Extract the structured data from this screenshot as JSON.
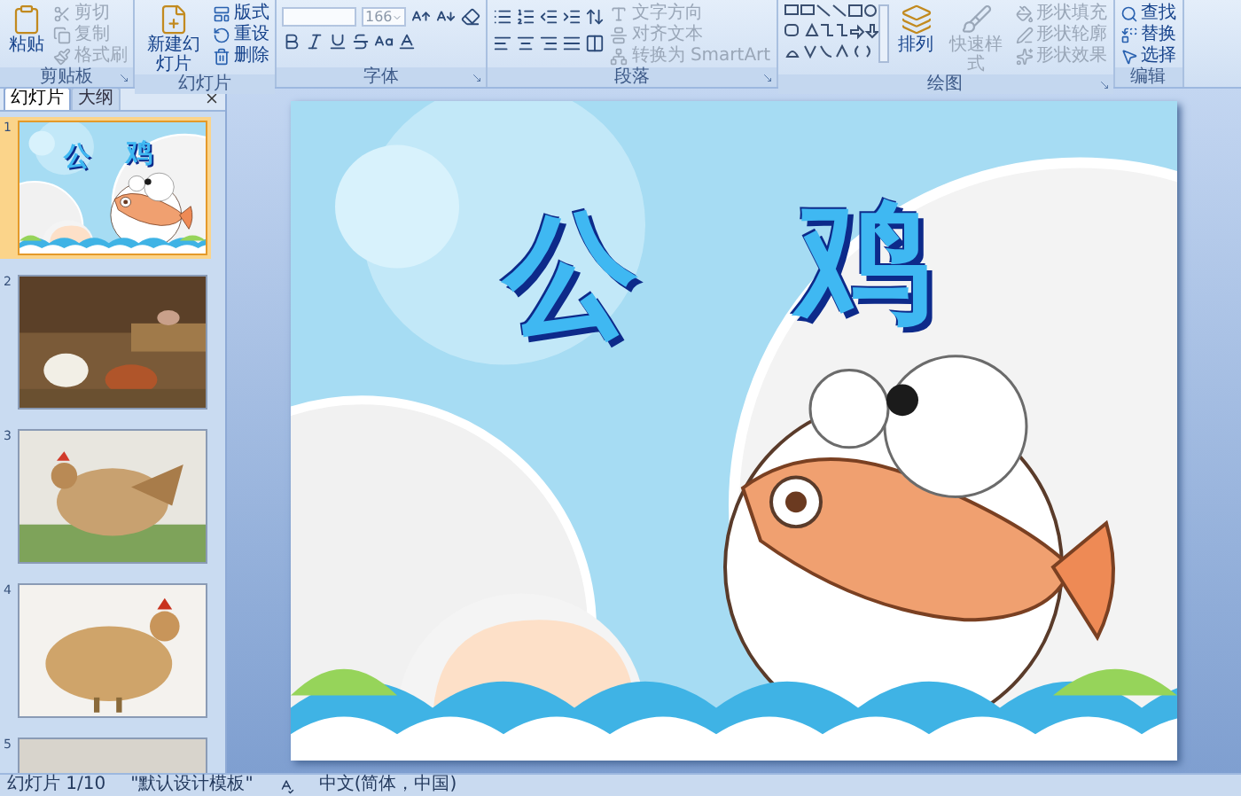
{
  "ribbon": {
    "groups": [
      {
        "label": "剪贴板",
        "kind": "buttons",
        "launcher": true,
        "large": [
          {
            "label": "粘贴",
            "disabled": false
          }
        ],
        "small": [
          {
            "label": "剪切",
            "disabled": true
          },
          {
            "label": "复制",
            "disabled": true
          },
          {
            "label": "格式刷",
            "disabled": true
          }
        ]
      },
      {
        "label": "幻灯片",
        "kind": "buttons",
        "launcher": false,
        "large": [
          {
            "label": "新建幻灯片",
            "disabled": false
          }
        ],
        "small": [
          {
            "label": "版式",
            "disabled": false
          },
          {
            "label": "重设",
            "disabled": false
          },
          {
            "label": "删除",
            "disabled": false
          }
        ]
      },
      {
        "label": "字体",
        "kind": "font",
        "launcher": true,
        "font_size": "166"
      },
      {
        "label": "段落",
        "kind": "paragraph",
        "launcher": true,
        "small": [
          {
            "label": "文字方向",
            "disabled": true
          },
          {
            "label": "对齐文本",
            "disabled": true
          },
          {
            "label": "转换为 SmartArt",
            "disabled": true
          }
        ]
      },
      {
        "label": "绘图",
        "kind": "drawing",
        "launcher": true,
        "large": [
          {
            "label": "排列",
            "disabled": false
          },
          {
            "label": "快速样式",
            "disabled": true
          }
        ],
        "small": [
          {
            "label": "形状填充",
            "disabled": true
          },
          {
            "label": "形状轮廓",
            "disabled": true
          },
          {
            "label": "形状效果",
            "disabled": true
          }
        ]
      },
      {
        "label": "编辑",
        "kind": "buttons",
        "launcher": false,
        "small": [
          {
            "label": "查找",
            "disabled": false
          },
          {
            "label": "替换",
            "disabled": false
          },
          {
            "label": "选择",
            "disabled": false
          }
        ]
      }
    ]
  },
  "pane": {
    "tabs": [
      {
        "label": "幻灯片",
        "selected": true
      },
      {
        "label": "大纲",
        "selected": false
      }
    ],
    "slides": [
      {
        "number": "1",
        "selected": true,
        "kind": "title",
        "title": [
          "公",
          "鸡"
        ]
      },
      {
        "number": "2",
        "selected": false,
        "kind": "picture"
      },
      {
        "number": "3",
        "selected": false,
        "kind": "picture"
      },
      {
        "number": "4",
        "selected": false,
        "kind": "picture"
      },
      {
        "number": "5",
        "selected": false,
        "kind": "picture"
      }
    ]
  },
  "slide": {
    "title": [
      "公",
      "鸡"
    ]
  },
  "status_bar": {
    "slide": "幻灯片 1/10",
    "theme": "\"默认设计模板\"",
    "language": "中文(简体，中国)"
  }
}
